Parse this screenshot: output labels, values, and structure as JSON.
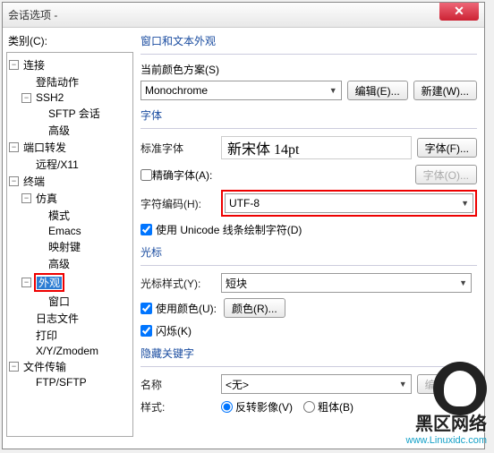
{
  "window": {
    "title": "会话选项 -"
  },
  "left": {
    "label": "类别(C):",
    "tree": [
      {
        "indent": 0,
        "toggle": "−",
        "label": "连接"
      },
      {
        "indent": 1,
        "toggle": "",
        "label": "登陆动作"
      },
      {
        "indent": 1,
        "toggle": "−",
        "label": "SSH2"
      },
      {
        "indent": 2,
        "toggle": "",
        "label": "SFTP 会话"
      },
      {
        "indent": 2,
        "toggle": "",
        "label": "高级"
      },
      {
        "indent": 0,
        "toggle": "−",
        "label": "端口转发"
      },
      {
        "indent": 1,
        "toggle": "",
        "label": "远程/X11"
      },
      {
        "indent": 0,
        "toggle": "−",
        "label": "终端"
      },
      {
        "indent": 1,
        "toggle": "−",
        "label": "仿真"
      },
      {
        "indent": 2,
        "toggle": "",
        "label": "模式"
      },
      {
        "indent": 2,
        "toggle": "",
        "label": "Emacs"
      },
      {
        "indent": 2,
        "toggle": "",
        "label": "映射键"
      },
      {
        "indent": 2,
        "toggle": "",
        "label": "高级"
      },
      {
        "indent": 1,
        "toggle": "−",
        "label": "外观",
        "selected": true,
        "redbox": true
      },
      {
        "indent": 2,
        "toggle": "",
        "label": "窗口"
      },
      {
        "indent": 1,
        "toggle": "",
        "label": "日志文件"
      },
      {
        "indent": 1,
        "toggle": "",
        "label": "打印"
      },
      {
        "indent": 1,
        "toggle": "",
        "label": "X/Y/Zmodem"
      },
      {
        "indent": 0,
        "toggle": "−",
        "label": "文件传输"
      },
      {
        "indent": 1,
        "toggle": "",
        "label": "FTP/SFTP"
      }
    ]
  },
  "right": {
    "section1": {
      "title": "窗口和文本外观",
      "scheme_label": "当前颜色方案(S)",
      "scheme_value": "Monochrome",
      "edit_btn": "编辑(E)...",
      "new_btn": "新建(W)..."
    },
    "section2": {
      "title": "字体",
      "std_font_label": "标准字体",
      "font_display": "新宋体  14pt",
      "font_btn": "字体(F)...",
      "exact_font_label": "精确字体(A):",
      "exact_font_btn": "字体(O)...",
      "encoding_label": "字符编码(H):",
      "encoding_value": "UTF-8",
      "unicode_label": "使用 Unicode 线条绘制字符(D)"
    },
    "section3": {
      "title": "光标",
      "style_label": "光标样式(Y):",
      "style_value": "短块",
      "use_color_label": "使用颜色(U):",
      "color_btn": "颜色(R)...",
      "blink_label": "闪烁(K)"
    },
    "section4": {
      "title": "隐藏关键字",
      "name_label": "名称",
      "name_value": "<无>",
      "edit_btn": "编辑(T)...",
      "style_label": "样式:",
      "radio1": "反转影像(V)",
      "radio2": "粗体(B)"
    }
  },
  "watermark": {
    "line1": "黑区网络",
    "line2": "www.Linuxidc.com"
  }
}
